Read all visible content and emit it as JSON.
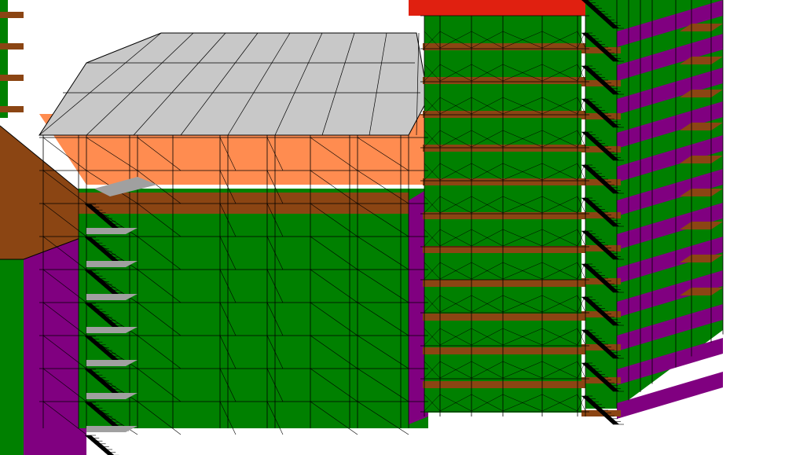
{
  "palette": {
    "background": "#ffffff",
    "roof": "#c8c8c8",
    "wall_green": "#008000",
    "deck_brown": "#8b4513",
    "beam_orange": "#ff8c50",
    "side_purple": "#800080",
    "top_red": "#e02010",
    "lines": "#000000",
    "landing_gray": "#a0a0a0"
  },
  "scene": {
    "description_visible_text": ""
  }
}
